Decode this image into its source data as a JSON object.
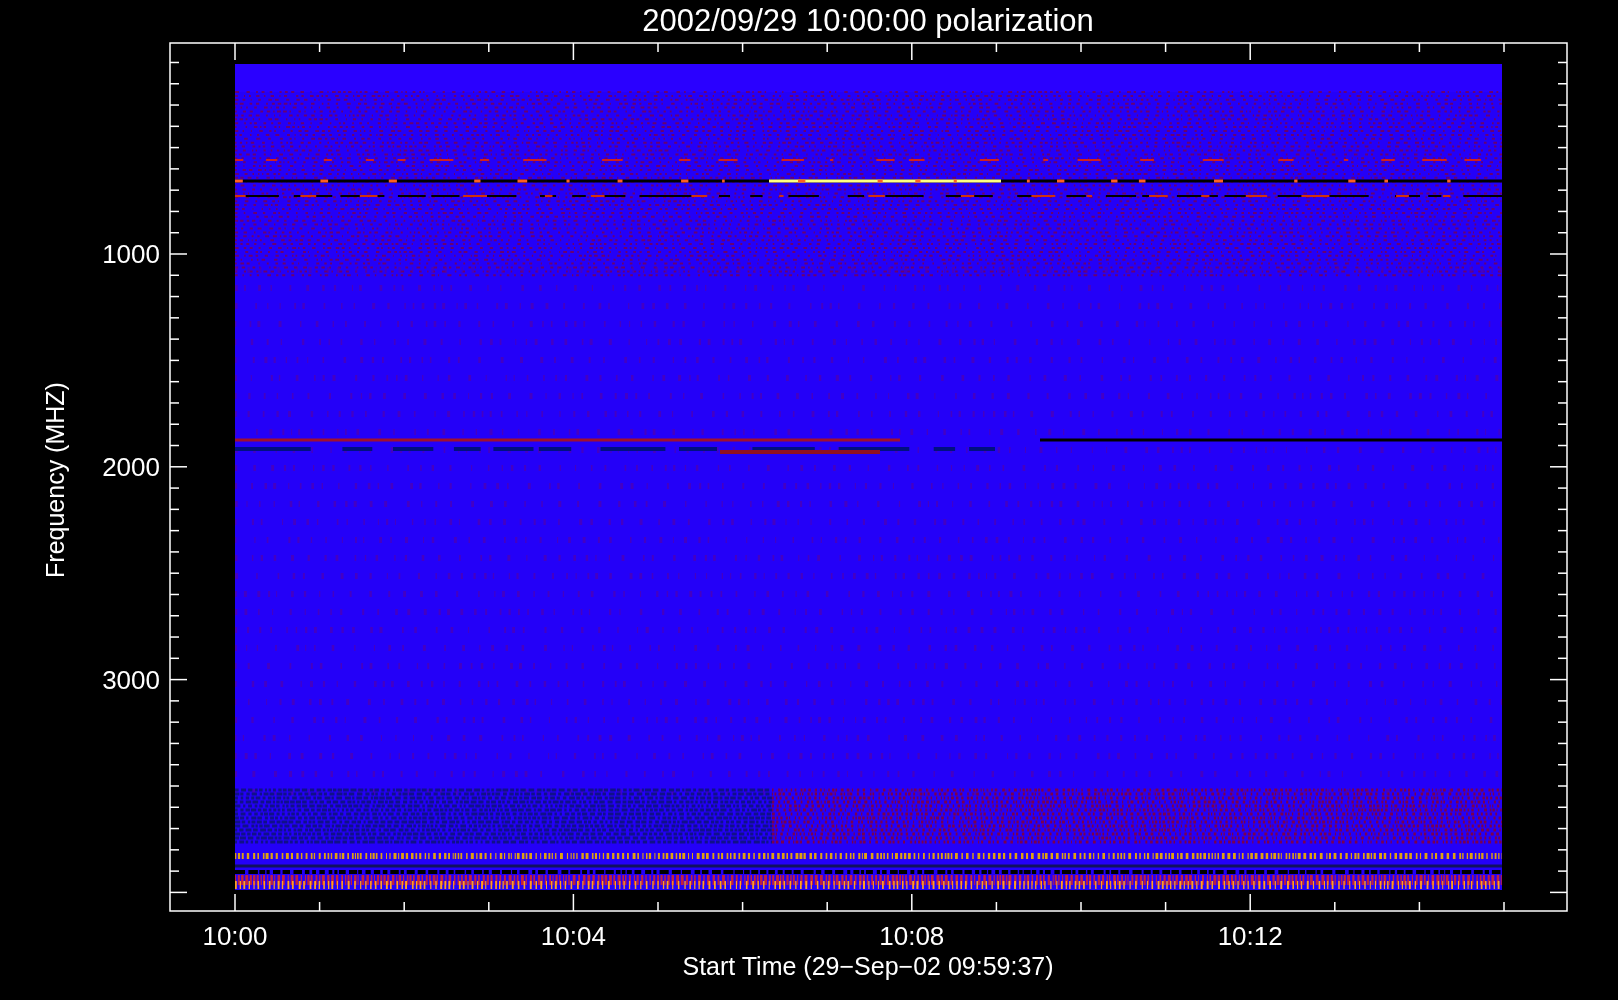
{
  "title": "2002/09/29 10:00:00 polarization",
  "y_axis": {
    "label": "Frequency (MHZ)",
    "ticks": [
      "1000",
      "2000",
      "3000"
    ]
  },
  "x_axis": {
    "label": "Start Time (29−Sep−02 09:59:37)",
    "ticks": [
      "10:00",
      "10:04",
      "10:08",
      "10:12"
    ]
  }
}
